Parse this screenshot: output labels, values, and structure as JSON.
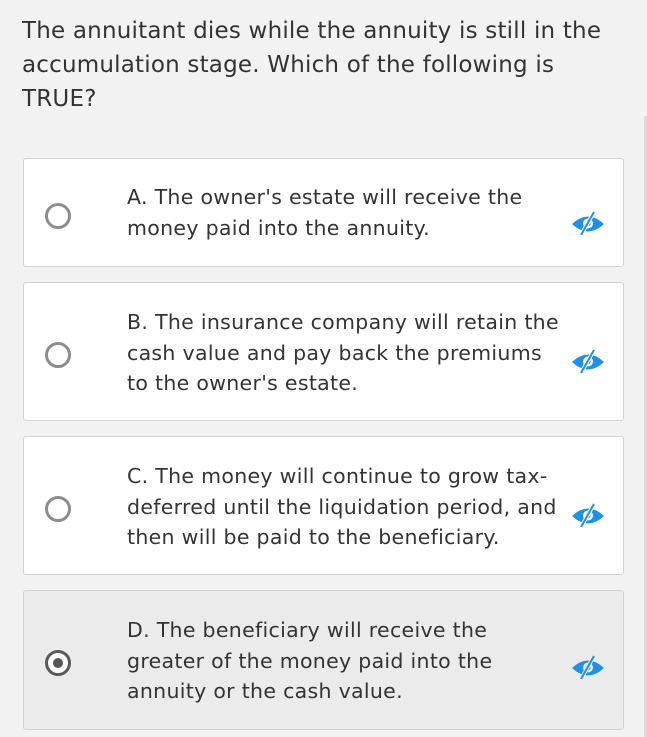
{
  "question": {
    "text": "The annuitant dies while the annuity is still in the accumulation stage. Which of the following is TRUE?"
  },
  "options": [
    {
      "label": "A. The owner's estate will receive the money paid into the annuity.",
      "selected": false,
      "icon": "eye-slash-icon"
    },
    {
      "label": "B. The insurance company will retain the cash value and pay back the premiums to the owner's estate.",
      "selected": false,
      "icon": "eye-slash-icon"
    },
    {
      "label": "C. The money will continue to grow tax-deferred until the liquidation period, and then will be paid to the beneficiary.",
      "selected": false,
      "icon": "eye-slash-icon"
    },
    {
      "label": "D. The beneficiary will receive the greater of the money paid into the annuity or the cash value.",
      "selected": true,
      "icon": "eye-slash-icon"
    }
  ],
  "colors": {
    "background": "#f2f2f2",
    "card": "#ffffff",
    "selected_card": "#ebebeb",
    "eye_icon": "#1e90e8",
    "text": "#333333"
  }
}
